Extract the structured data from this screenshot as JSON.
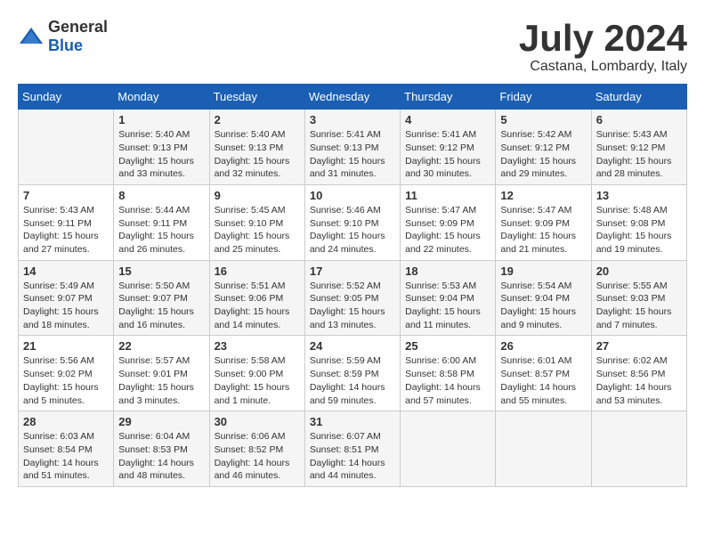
{
  "header": {
    "logo_general": "General",
    "logo_blue": "Blue",
    "month_year": "July 2024",
    "location": "Castana, Lombardy, Italy"
  },
  "calendar": {
    "days_of_week": [
      "Sunday",
      "Monday",
      "Tuesday",
      "Wednesday",
      "Thursday",
      "Friday",
      "Saturday"
    ],
    "weeks": [
      [
        {
          "day": "",
          "info": ""
        },
        {
          "day": "1",
          "info": "Sunrise: 5:40 AM\nSunset: 9:13 PM\nDaylight: 15 hours\nand 33 minutes."
        },
        {
          "day": "2",
          "info": "Sunrise: 5:40 AM\nSunset: 9:13 PM\nDaylight: 15 hours\nand 32 minutes."
        },
        {
          "day": "3",
          "info": "Sunrise: 5:41 AM\nSunset: 9:13 PM\nDaylight: 15 hours\nand 31 minutes."
        },
        {
          "day": "4",
          "info": "Sunrise: 5:41 AM\nSunset: 9:12 PM\nDaylight: 15 hours\nand 30 minutes."
        },
        {
          "day": "5",
          "info": "Sunrise: 5:42 AM\nSunset: 9:12 PM\nDaylight: 15 hours\nand 29 minutes."
        },
        {
          "day": "6",
          "info": "Sunrise: 5:43 AM\nSunset: 9:12 PM\nDaylight: 15 hours\nand 28 minutes."
        }
      ],
      [
        {
          "day": "7",
          "info": "Sunrise: 5:43 AM\nSunset: 9:11 PM\nDaylight: 15 hours\nand 27 minutes."
        },
        {
          "day": "8",
          "info": "Sunrise: 5:44 AM\nSunset: 9:11 PM\nDaylight: 15 hours\nand 26 minutes."
        },
        {
          "day": "9",
          "info": "Sunrise: 5:45 AM\nSunset: 9:10 PM\nDaylight: 15 hours\nand 25 minutes."
        },
        {
          "day": "10",
          "info": "Sunrise: 5:46 AM\nSunset: 9:10 PM\nDaylight: 15 hours\nand 24 minutes."
        },
        {
          "day": "11",
          "info": "Sunrise: 5:47 AM\nSunset: 9:09 PM\nDaylight: 15 hours\nand 22 minutes."
        },
        {
          "day": "12",
          "info": "Sunrise: 5:47 AM\nSunset: 9:09 PM\nDaylight: 15 hours\nand 21 minutes."
        },
        {
          "day": "13",
          "info": "Sunrise: 5:48 AM\nSunset: 9:08 PM\nDaylight: 15 hours\nand 19 minutes."
        }
      ],
      [
        {
          "day": "14",
          "info": "Sunrise: 5:49 AM\nSunset: 9:07 PM\nDaylight: 15 hours\nand 18 minutes."
        },
        {
          "day": "15",
          "info": "Sunrise: 5:50 AM\nSunset: 9:07 PM\nDaylight: 15 hours\nand 16 minutes."
        },
        {
          "day": "16",
          "info": "Sunrise: 5:51 AM\nSunset: 9:06 PM\nDaylight: 15 hours\nand 14 minutes."
        },
        {
          "day": "17",
          "info": "Sunrise: 5:52 AM\nSunset: 9:05 PM\nDaylight: 15 hours\nand 13 minutes."
        },
        {
          "day": "18",
          "info": "Sunrise: 5:53 AM\nSunset: 9:04 PM\nDaylight: 15 hours\nand 11 minutes."
        },
        {
          "day": "19",
          "info": "Sunrise: 5:54 AM\nSunset: 9:04 PM\nDaylight: 15 hours\nand 9 minutes."
        },
        {
          "day": "20",
          "info": "Sunrise: 5:55 AM\nSunset: 9:03 PM\nDaylight: 15 hours\nand 7 minutes."
        }
      ],
      [
        {
          "day": "21",
          "info": "Sunrise: 5:56 AM\nSunset: 9:02 PM\nDaylight: 15 hours\nand 5 minutes."
        },
        {
          "day": "22",
          "info": "Sunrise: 5:57 AM\nSunset: 9:01 PM\nDaylight: 15 hours\nand 3 minutes."
        },
        {
          "day": "23",
          "info": "Sunrise: 5:58 AM\nSunset: 9:00 PM\nDaylight: 15 hours\nand 1 minute."
        },
        {
          "day": "24",
          "info": "Sunrise: 5:59 AM\nSunset: 8:59 PM\nDaylight: 14 hours\nand 59 minutes."
        },
        {
          "day": "25",
          "info": "Sunrise: 6:00 AM\nSunset: 8:58 PM\nDaylight: 14 hours\nand 57 minutes."
        },
        {
          "day": "26",
          "info": "Sunrise: 6:01 AM\nSunset: 8:57 PM\nDaylight: 14 hours\nand 55 minutes."
        },
        {
          "day": "27",
          "info": "Sunrise: 6:02 AM\nSunset: 8:56 PM\nDaylight: 14 hours\nand 53 minutes."
        }
      ],
      [
        {
          "day": "28",
          "info": "Sunrise: 6:03 AM\nSunset: 8:54 PM\nDaylight: 14 hours\nand 51 minutes."
        },
        {
          "day": "29",
          "info": "Sunrise: 6:04 AM\nSunset: 8:53 PM\nDaylight: 14 hours\nand 48 minutes."
        },
        {
          "day": "30",
          "info": "Sunrise: 6:06 AM\nSunset: 8:52 PM\nDaylight: 14 hours\nand 46 minutes."
        },
        {
          "day": "31",
          "info": "Sunrise: 6:07 AM\nSunset: 8:51 PM\nDaylight: 14 hours\nand 44 minutes."
        },
        {
          "day": "",
          "info": ""
        },
        {
          "day": "",
          "info": ""
        },
        {
          "day": "",
          "info": ""
        }
      ]
    ]
  }
}
